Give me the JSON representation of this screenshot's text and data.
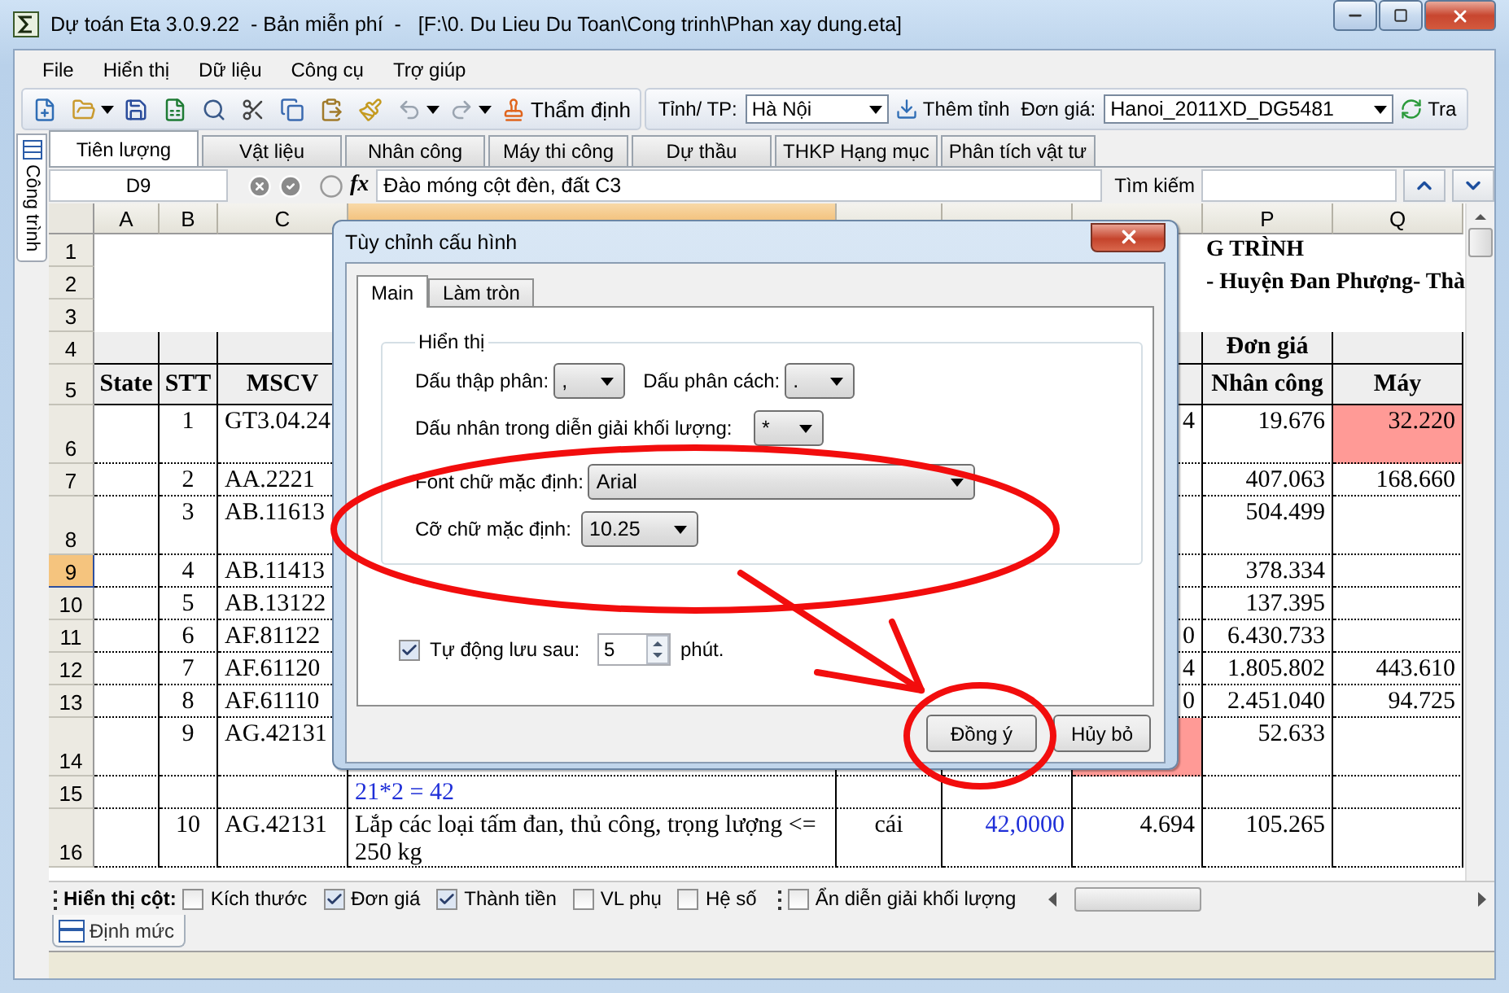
{
  "window": {
    "title": "Dự toán Eta 3.0.9.22  - Bản miễn phí  -   [F:\\0. Du Lieu Du Toan\\Cong trinh\\Phan xay dung.eta]"
  },
  "menu": [
    "File",
    "Hiển thị",
    "Dữ liệu",
    "Công cụ",
    "Trợ giúp"
  ],
  "toolbar": {
    "review_button": "Thẩm định",
    "province_label": "Tỉnh/ TP:",
    "province": "Hà Nội",
    "add_province_button": "Thêm tỉnh",
    "price_label": "Đơn giá:",
    "price_set": "Hanoi_2011XD_DG5481",
    "lookup_button": "Tra"
  },
  "side_tab": {
    "label": "Công trình"
  },
  "tabs": [
    {
      "label": "Tiên lượng",
      "selected": true
    },
    {
      "label": "Vật liệu",
      "selected": false
    },
    {
      "label": "Nhân công",
      "selected": false
    },
    {
      "label": "Máy thi công",
      "selected": false
    },
    {
      "label": "Dự thầu",
      "selected": false
    },
    {
      "label": "THKP Hạng mục",
      "selected": false
    },
    {
      "label": "Phân tích vật tư",
      "selected": false
    }
  ],
  "formula_bar": {
    "cell": "D9",
    "fx": "fx",
    "value": "Đào móng cột đèn, đất C3",
    "search_label": "Tìm kiếm"
  },
  "sheet": {
    "columns": [
      {
        "label": "A",
        "selected": false
      },
      {
        "label": "B",
        "selected": false
      },
      {
        "label": "C",
        "selected": false
      },
      {
        "selected": true
      },
      {
        "selected": false
      },
      {
        "selected": false
      },
      {
        "selected": false
      },
      {
        "label": "P",
        "selected": false
      },
      {
        "label": "Q",
        "selected": false
      }
    ],
    "rows": [
      {
        "label": "1",
        "selected": false,
        "kind": "title",
        "cells": [
          {},
          {},
          {},
          {},
          {},
          {},
          {},
          {
            "text": "G TRÌNH"
          },
          {}
        ]
      },
      {
        "label": "2",
        "selected": false,
        "kind": "title",
        "cells": [
          {},
          {},
          {},
          {},
          {},
          {},
          {},
          {
            "text": "- Huyện Đan Phượng- Thà"
          },
          {}
        ]
      },
      {
        "label": "3",
        "selected": false,
        "kind": "title",
        "cells": [
          {},
          {},
          {},
          {},
          {},
          {},
          {},
          {},
          {}
        ]
      },
      {
        "label": "4",
        "selected": false,
        "kind": "header",
        "cells": [
          {},
          {},
          {},
          {},
          {},
          {},
          {},
          {
            "text": "Đơn giá"
          },
          {}
        ]
      },
      {
        "label": "5",
        "selected": false,
        "kind": "header",
        "cells": [
          {
            "text": "State"
          },
          {
            "text": "STT"
          },
          {
            "text": "MSCV"
          },
          {},
          {},
          {},
          {},
          {
            "text": "Nhân công"
          },
          {
            "text": "Máy"
          }
        ]
      },
      {
        "label": "6",
        "selected": false,
        "kind": "data",
        "cells": [
          {},
          {
            "text": "1"
          },
          {
            "text": "GT3.04.24"
          },
          {},
          {},
          {},
          {
            "text": "4"
          },
          {
            "text": "19.676"
          },
          {
            "text": "32.220",
            "highlight": true
          }
        ]
      },
      {
        "label": "7",
        "selected": false,
        "kind": "data",
        "cells": [
          {},
          {
            "text": "2"
          },
          {
            "text": "AA.2221"
          },
          {},
          {},
          {},
          {},
          {
            "text": "407.063"
          },
          {
            "text": "168.660"
          }
        ]
      },
      {
        "label": "8",
        "selected": false,
        "kind": "data",
        "cells": [
          {},
          {
            "text": "3"
          },
          {
            "text": "AB.11613"
          },
          {},
          {},
          {},
          {},
          {
            "text": "504.499"
          },
          {}
        ]
      },
      {
        "label": "9",
        "selected": true,
        "kind": "data",
        "cells": [
          {},
          {
            "text": "4"
          },
          {
            "text": "AB.11413"
          },
          {},
          {},
          {},
          {},
          {
            "text": "378.334"
          },
          {}
        ]
      },
      {
        "label": "10",
        "selected": false,
        "kind": "data",
        "cells": [
          {},
          {
            "text": "5"
          },
          {
            "text": "AB.13122"
          },
          {},
          {},
          {},
          {},
          {
            "text": "137.395"
          },
          {}
        ]
      },
      {
        "label": "11",
        "selected": false,
        "kind": "data",
        "cells": [
          {},
          {
            "text": "6"
          },
          {
            "text": "AF.81122"
          },
          {},
          {},
          {},
          {
            "text": "0"
          },
          {
            "text": "6.430.733"
          },
          {}
        ]
      },
      {
        "label": "12",
        "selected": false,
        "kind": "data",
        "cells": [
          {},
          {
            "text": "7"
          },
          {
            "text": "AF.61120"
          },
          {},
          {},
          {},
          {
            "text": "4"
          },
          {
            "text": "1.805.802"
          },
          {
            "text": "443.610"
          }
        ]
      },
      {
        "label": "13",
        "selected": false,
        "kind": "data",
        "cells": [
          {},
          {
            "text": "8"
          },
          {
            "text": "AF.61110"
          },
          {},
          {},
          {},
          {
            "text": "0"
          },
          {
            "text": "2.451.040"
          },
          {
            "text": "94.725"
          }
        ]
      },
      {
        "label": "14",
        "selected": false,
        "kind": "data",
        "cells": [
          {},
          {
            "text": "9"
          },
          {
            "text": "AG.42131"
          },
          {},
          {},
          {},
          {
            "highlight": true
          },
          {
            "text": "52.633"
          },
          {}
        ]
      },
      {
        "label": "15",
        "selected": false,
        "kind": "data",
        "cells": [
          {},
          {},
          {},
          {
            "text": "21*2 = 42",
            "kind": "formula"
          },
          {},
          {},
          {},
          {},
          {}
        ]
      },
      {
        "label": "16",
        "selected": false,
        "kind": "data",
        "cells": [
          {},
          {
            "text": "10"
          },
          {
            "text": "AG.42131"
          },
          {
            "text": "Lắp các loại tấm đan, thủ công, trọng lượng <= 250 kg"
          },
          {
            "text": "cái"
          },
          {
            "text": "42,0000",
            "kind": "formula"
          },
          {
            "text": "4.694"
          },
          {
            "text": "105.265"
          },
          {}
        ]
      }
    ]
  },
  "column_options": {
    "label": "Hiển thị cột:",
    "items": [
      {
        "label": "Kích thước",
        "checked": false
      },
      {
        "label": "Đơn giá",
        "checked": true
      },
      {
        "label": "Thành tiền",
        "checked": true
      },
      {
        "label": "VL phụ",
        "checked": false
      },
      {
        "label": "Hệ số",
        "checked": false
      }
    ],
    "extra": {
      "label": "Ẩn diễn giải khối lượng",
      "checked": false
    }
  },
  "sheet_tabs": [
    {
      "label": "Định mức"
    }
  ],
  "dialog": {
    "title": "Tùy chỉnh cấu hình",
    "tabs": [
      {
        "label": "Main",
        "selected": true
      },
      {
        "label": "Làm tròn",
        "selected": false
      }
    ],
    "group": "Hiển thị",
    "decimal_label": "Dấu thập phân:",
    "decimal": ",",
    "separator_label": "Dấu phân cách:",
    "separator": ".",
    "multiply_label": "Dấu nhân trong diễn giải khối lượng:",
    "multiply": "*",
    "font_label": "Font chữ mặc định:",
    "font": "Arial",
    "size_label": "Cỡ chữ mặc định:",
    "size": "10.25",
    "autosave": {
      "label": "Tự động lưu sau:",
      "checked": true,
      "value": "5",
      "unit": "phút."
    },
    "buttons": [
      "Đồng ý",
      "Hủy bỏ"
    ]
  }
}
